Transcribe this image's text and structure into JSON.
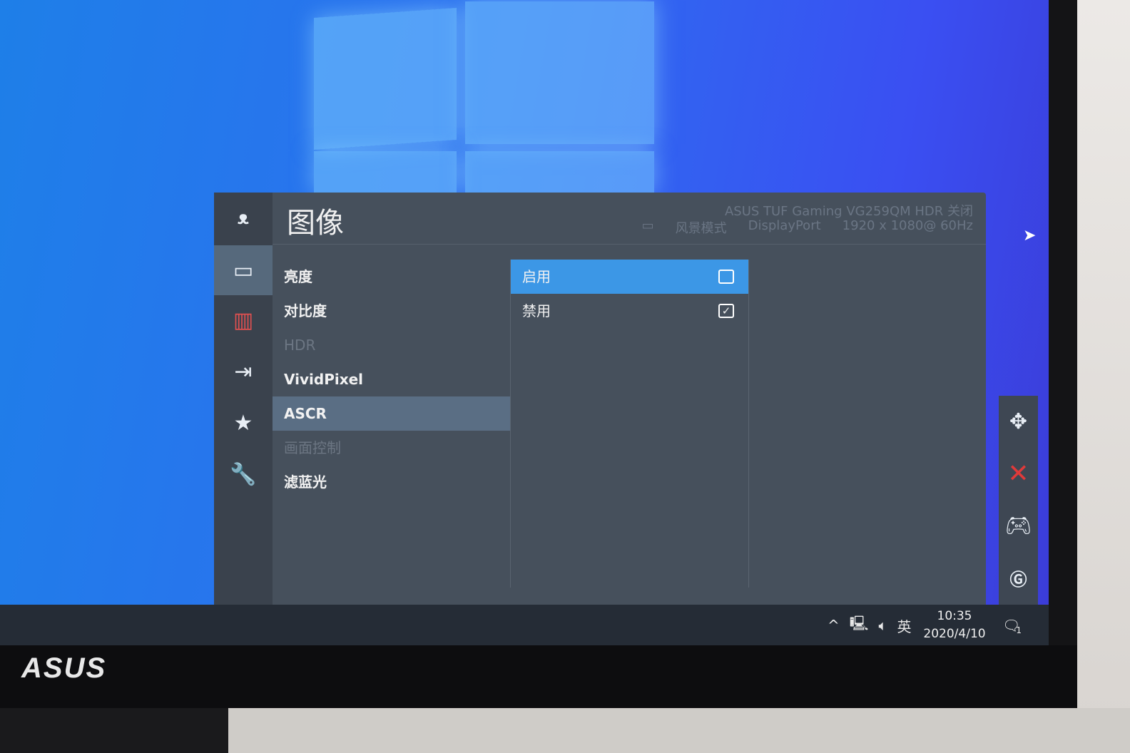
{
  "osd": {
    "title": "图像",
    "header_line1": "ASUS TUF Gaming   VG259QM  HDR 关闭",
    "header_mode": "风景模式",
    "header_input": "DisplayPort",
    "header_res": "1920 x 1080@   60Hz",
    "sidebar_icons": [
      "tuf-logo-icon",
      "image-icon",
      "color-icon",
      "input-icon",
      "favorite-star-icon",
      "wrench-icon"
    ],
    "menu": [
      {
        "label": "亮度",
        "state": "normal"
      },
      {
        "label": "对比度",
        "state": "normal"
      },
      {
        "label": "HDR",
        "state": "disabled"
      },
      {
        "label": "VividPixel",
        "state": "normal"
      },
      {
        "label": "ASCR",
        "state": "selected"
      },
      {
        "label": "画面控制",
        "state": "disabled"
      },
      {
        "label": "滤蓝光",
        "state": "normal"
      }
    ],
    "options": [
      {
        "label": "启用",
        "checked": false,
        "highlighted": true
      },
      {
        "label": "禁用",
        "checked": true,
        "highlighted": false
      }
    ]
  },
  "hotkeys": [
    "navigate-icon",
    "close-icon",
    "gamepad-icon",
    "gameplus-icon"
  ],
  "taskbar": {
    "ime": "英",
    "time": "10:35",
    "date": "2020/4/10",
    "notification_count": "1"
  },
  "bezel_logo": "ASUS"
}
